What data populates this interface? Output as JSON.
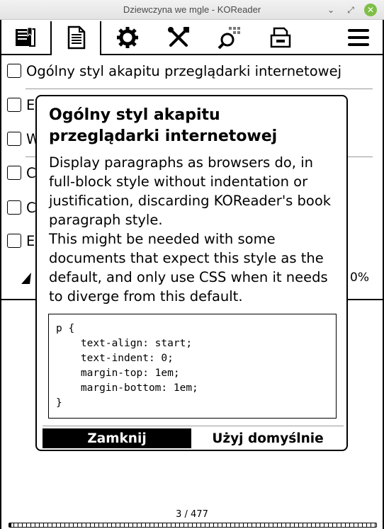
{
  "window": {
    "title": "Dziewczyna we mgle - KOReader"
  },
  "toolbar": {
    "icons": [
      "bookmark-icon",
      "document-icon",
      "gear-icon",
      "tools-icon",
      "search-icon",
      "inbox-icon",
      "hamburger-menu-icon"
    ],
    "active_tab": "document-icon"
  },
  "menu": {
    "items": [
      {
        "label": "Ogólny styl akapitu przeglądarki internetowej"
      },
      {
        "label": "E"
      },
      {
        "label": "W"
      },
      {
        "label": "C"
      },
      {
        "label": "C"
      },
      {
        "label": "E"
      }
    ],
    "percent_label": "0%"
  },
  "dialog": {
    "title": "Ogólny styl akapitu przeglądarki internetowej",
    "paragraph1": "Display paragraphs as browsers do, in full-block style without indentation or justification, discarding KOReader's book paragraph style.",
    "paragraph2": "This might be needed with some documents that expect this style as the default, and only use CSS when it needs to diverge from this default.",
    "code": "p {\n    text-align: start;\n    text-indent: 0;\n    margin-top: 1em;\n    margin-bottom: 1em;\n}",
    "close_label": "Zamknij",
    "default_label": "Użyj domyślnie"
  },
  "footer": {
    "page": "3 / 477",
    "progress": 0.006
  }
}
